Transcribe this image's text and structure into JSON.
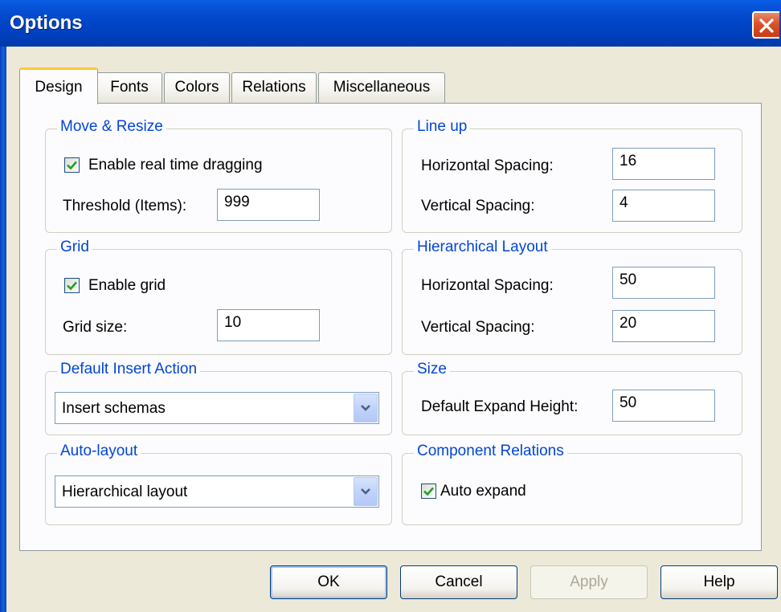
{
  "window": {
    "title": "Options"
  },
  "tabs": [
    {
      "label": "Design",
      "active": true
    },
    {
      "label": "Fonts",
      "active": false
    },
    {
      "label": "Colors",
      "active": false
    },
    {
      "label": "Relations",
      "active": false
    },
    {
      "label": "Miscellaneous",
      "active": false
    }
  ],
  "move_resize": {
    "title": "Move & Resize",
    "enable_dragging_label": "Enable real time dragging",
    "enable_dragging_checked": true,
    "threshold_label": "Threshold (Items):",
    "threshold_value": "999"
  },
  "grid": {
    "title": "Grid",
    "enable_grid_label": "Enable grid",
    "enable_grid_checked": true,
    "grid_size_label": "Grid size:",
    "grid_size_value": "10"
  },
  "default_insert": {
    "title": "Default Insert Action",
    "selected": "Insert schemas"
  },
  "auto_layout": {
    "title": "Auto-layout",
    "selected": "Hierarchical layout"
  },
  "line_up": {
    "title": "Line up",
    "h_label": "Horizontal Spacing:",
    "h_value": "16",
    "v_label": "Vertical Spacing:",
    "v_value": "4"
  },
  "hierarchical": {
    "title": "Hierarchical Layout",
    "h_label": "Horizontal Spacing:",
    "h_value": "50",
    "v_label": "Vertical Spacing:",
    "v_value": "20"
  },
  "size": {
    "title": "Size",
    "expand_label": "Default Expand Height:",
    "expand_value": "50"
  },
  "component_relations": {
    "title": "Component Relations",
    "auto_expand_label": "Auto expand",
    "auto_expand_checked": true
  },
  "buttons": {
    "ok": "OK",
    "cancel": "Cancel",
    "apply": "Apply",
    "help": "Help"
  },
  "colors": {
    "titlebar": "#0046c8",
    "group_title": "#0046d5",
    "dialog_bg": "#ece9d8",
    "check_mark": "#21a121"
  }
}
